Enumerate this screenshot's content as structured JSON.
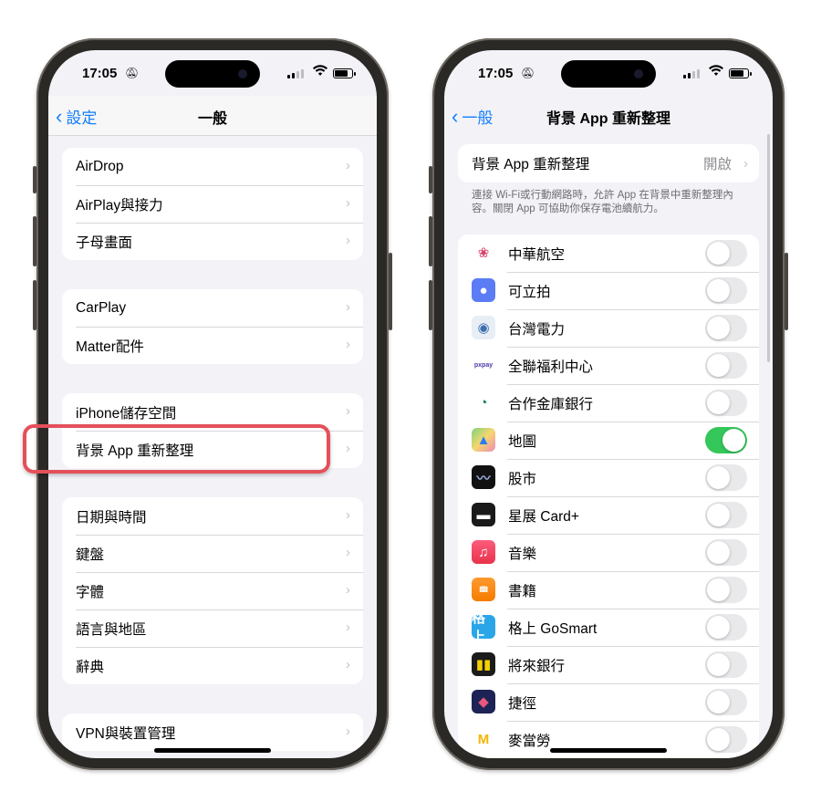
{
  "status_bar": {
    "time": "17:05",
    "silent_icon": "bell-slash-icon"
  },
  "left_screen": {
    "back_label": "設定",
    "title": "一般",
    "groups": [
      [
        "AirDrop",
        "AirPlay與接力",
        "子母畫面"
      ],
      [
        "CarPlay",
        "Matter配件"
      ],
      [
        "iPhone儲存空間",
        "背景 App 重新整理"
      ],
      [
        "日期與時間",
        "鍵盤",
        "字體",
        "語言與地區",
        "辭典"
      ],
      [
        "VPN與裝置管理"
      ]
    ],
    "highlighted_item": "背景 App 重新整理",
    "highlight_color": "#e4505a"
  },
  "right_screen": {
    "back_label": "一般",
    "title": "背景 App 重新整理",
    "setting": {
      "label": "背景 App 重新整理",
      "value": "開啟"
    },
    "footnote": "連接 Wi-Fi或行動網路時，允許 App 在背景中重新整理內容。關閉 App 可協助你保存電池續航力。",
    "apps": [
      {
        "name": "中華航空",
        "icon": "china-airlines-icon",
        "enabled": false
      },
      {
        "name": "可立拍",
        "icon": "clips-icon",
        "enabled": false
      },
      {
        "name": "台灣電力",
        "icon": "taipower-icon",
        "enabled": false
      },
      {
        "name": "全聯福利中心",
        "icon": "pxpay-icon",
        "enabled": false
      },
      {
        "name": "合作金庫銀行",
        "icon": "tcb-bank-icon",
        "enabled": false
      },
      {
        "name": "地圖",
        "icon": "maps-icon",
        "enabled": true
      },
      {
        "name": "股市",
        "icon": "stocks-icon",
        "enabled": false
      },
      {
        "name": "星展 Card+",
        "icon": "dbs-card-icon",
        "enabled": false
      },
      {
        "name": "音樂",
        "icon": "music-icon",
        "enabled": false
      },
      {
        "name": "書籍",
        "icon": "books-icon",
        "enabled": false
      },
      {
        "name": "格上 GoSmart",
        "icon": "gosmart-icon",
        "enabled": false
      },
      {
        "name": "將來銀行",
        "icon": "next-bank-icon",
        "enabled": false
      },
      {
        "name": "捷徑",
        "icon": "shortcuts-icon",
        "enabled": false
      },
      {
        "name": "麥當勞",
        "icon": "mcdonalds-icon",
        "enabled": false
      }
    ]
  },
  "colors": {
    "accent": "#147efb",
    "toggle_on": "#34c759",
    "toggle_off": "#e9e9eb",
    "background": "#f2f2f7"
  }
}
